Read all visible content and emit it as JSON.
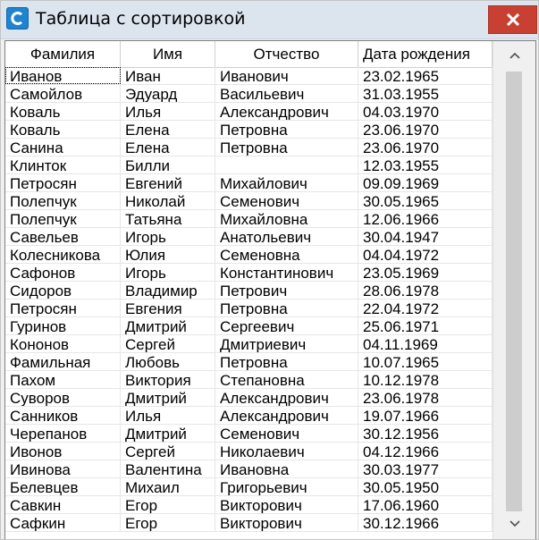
{
  "window": {
    "title": "Таблица с сортировкой"
  },
  "table": {
    "columns": [
      "Фамилия",
      "Имя",
      "Отчество",
      "Дата рождения"
    ],
    "rows": [
      [
        "Иванов",
        "Иван",
        "Иванович",
        "23.02.1965"
      ],
      [
        "Самойлов",
        "Эдуард",
        "Васильевич",
        "31.03.1955"
      ],
      [
        "Коваль",
        "Илья",
        "Александрович",
        "04.03.1970"
      ],
      [
        "Коваль",
        "Елена",
        "Петровна",
        "23.06.1970"
      ],
      [
        "Санина",
        "Елена",
        "Петровна",
        "23.06.1970"
      ],
      [
        "Клинток",
        "Билли",
        "",
        "12.03.1955"
      ],
      [
        "Петросян",
        "Евгений",
        "Михайлович",
        "09.09.1969"
      ],
      [
        "Полепчук",
        "Николай",
        "Семенович",
        "30.05.1965"
      ],
      [
        "Полепчук",
        "Татьяна",
        "Михайловна",
        "12.06.1966"
      ],
      [
        "Савельев",
        "Игорь",
        "Анатольевич",
        "30.04.1947"
      ],
      [
        "Колесникова",
        "Юлия",
        "Семеновна",
        "04.04.1972"
      ],
      [
        "Сафонов",
        "Игорь",
        "Константинович",
        "23.05.1969"
      ],
      [
        "Сидоров",
        "Владимир",
        "Петрович",
        "28.06.1978"
      ],
      [
        "Петросян",
        "Евгения",
        "Петровна",
        "22.04.1972"
      ],
      [
        "Гуринов",
        "Дмитрий",
        "Сергеевич",
        "25.06.1971"
      ],
      [
        "Кононов",
        "Сергей",
        "Дмитриевич",
        "04.11.1969"
      ],
      [
        "Фамильная",
        "Любовь",
        "Петровна",
        "10.07.1965"
      ],
      [
        "Пахом",
        "Виктория",
        "Степановна",
        "10.12.1978"
      ],
      [
        "Суворов",
        "Дмитрий",
        "Александрович",
        "23.06.1978"
      ],
      [
        "Санников",
        "Илья",
        "Александрович",
        "19.07.1966"
      ],
      [
        "Черепанов",
        "Дмитрий",
        "Семенович",
        "30.12.1956"
      ],
      [
        "Ивонов",
        "Сергей",
        "Николаевич",
        "04.12.1966"
      ],
      [
        "Ивинова",
        "Валентина",
        "Ивановна",
        "30.03.1977"
      ],
      [
        "Белевцев",
        "Михаил",
        "Григорьевич",
        "30.05.1950"
      ],
      [
        "Савкин",
        "Егор",
        "Викторович",
        "17.06.1960"
      ],
      [
        "Сафкин",
        "Егор",
        "Викторович",
        "30.12.1966"
      ]
    ]
  },
  "icons": {
    "app": "app-c-icon",
    "close": "close-icon",
    "scroll_up": "chevron-up-icon",
    "scroll_down": "chevron-down-icon"
  }
}
